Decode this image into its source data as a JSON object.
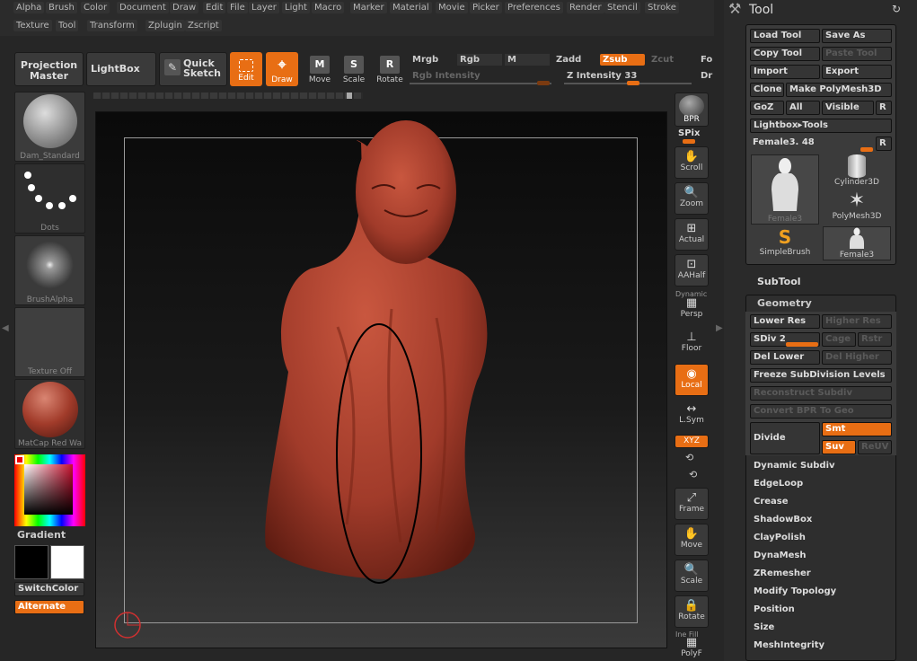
{
  "menu_row1": [
    "Alpha",
    "Brush",
    "Color",
    "Document",
    "Draw",
    "Edit",
    "File",
    "Layer",
    "Light",
    "Macro",
    "Marker",
    "Material",
    "Movie",
    "Picker",
    "Preferences",
    "Render",
    "Stencil",
    "Stroke"
  ],
  "menu_row2": [
    "Texture",
    "Tool",
    "Transform",
    "Zplugin",
    "Zscript"
  ],
  "toolbar": {
    "projection_master": "Projection Master",
    "lightbox": "LightBox",
    "quick_sketch": "Quick Sketch",
    "edit": "Edit",
    "draw": "Draw",
    "move": "Move",
    "scale": "Scale",
    "rotate": "Rotate",
    "move_glyph": "M",
    "scale_glyph": "S",
    "rotate_glyph": "R",
    "mrgb": "Mrgb",
    "rgb": "Rgb",
    "m": "M",
    "zadd": "Zadd",
    "zsub": "Zsub",
    "zcut": "Zcut",
    "rgb_intensity": "Rgb Intensity",
    "z_intensity": "Z Intensity 33",
    "fc": "Fo",
    "dr": "Dr"
  },
  "left_shelf": {
    "brush": "Dam_Standard",
    "stroke": "Dots",
    "alpha": "BrushAlpha",
    "texture": "Texture Off",
    "material": "MatCap Red Wa",
    "gradient": "Gradient",
    "switch_color": "SwitchColor",
    "alternate": "Alternate"
  },
  "right_shelf": {
    "bpr": "BPR",
    "spix": "SPix",
    "scroll": "Scroll",
    "zoom": "Zoom",
    "actual": "Actual",
    "aahalf": "AAHalf",
    "dynamic": "Dynamic",
    "persp": "Persp",
    "floor": "Floor",
    "local": "Local",
    "lsym": "L.Sym",
    "xyz": "XYZ",
    "frame": "Frame",
    "move": "Move",
    "scale": "Scale",
    "rotate": "Rotate",
    "line_fill": "Ine Fill",
    "polyf": "PolyF"
  },
  "tool_palette": {
    "title": "Tool",
    "load_tool": "Load Tool",
    "save_as": "Save As",
    "copy_tool": "Copy Tool",
    "paste_tool": "Paste Tool",
    "import": "Import",
    "export": "Export",
    "clone": "Clone",
    "make_polymesh": "Make PolyMesh3D",
    "goz": "GoZ",
    "all": "All",
    "visible": "Visible",
    "r": "R",
    "lightbox_tools": "Lightbox▸Tools",
    "current_tool": "Female3. 48",
    "tools": [
      "Female3",
      "Cylinder3D",
      "PolyMesh3D",
      "SimpleBrush",
      "Female3"
    ]
  },
  "subtool": {
    "label": "SubTool"
  },
  "geometry": {
    "label": "Geometry",
    "lower_res": "Lower Res",
    "higher_res": "Higher Res",
    "sdiv": "SDiv 2",
    "cage": "Cage",
    "rstr": "Rstr",
    "del_lower": "Del Lower",
    "del_higher": "Del Higher",
    "freeze": "Freeze SubDivision Levels",
    "reconstruct": "Reconstruct Subdiv",
    "convert_bpr": "Convert BPR To Geo",
    "divide": "Divide",
    "smt": "Smt",
    "suv": "Suv",
    "reuv": "ReUV",
    "items": [
      "Dynamic Subdiv",
      "EdgeLoop",
      "Crease",
      "ShadowBox",
      "ClayPolish",
      "DynaMesh",
      "ZRemesher",
      "Modify Topology",
      "Position",
      "Size",
      "MeshIntegrity"
    ]
  },
  "colors": {
    "accent": "#e86e14",
    "model": "#a13b2a"
  }
}
